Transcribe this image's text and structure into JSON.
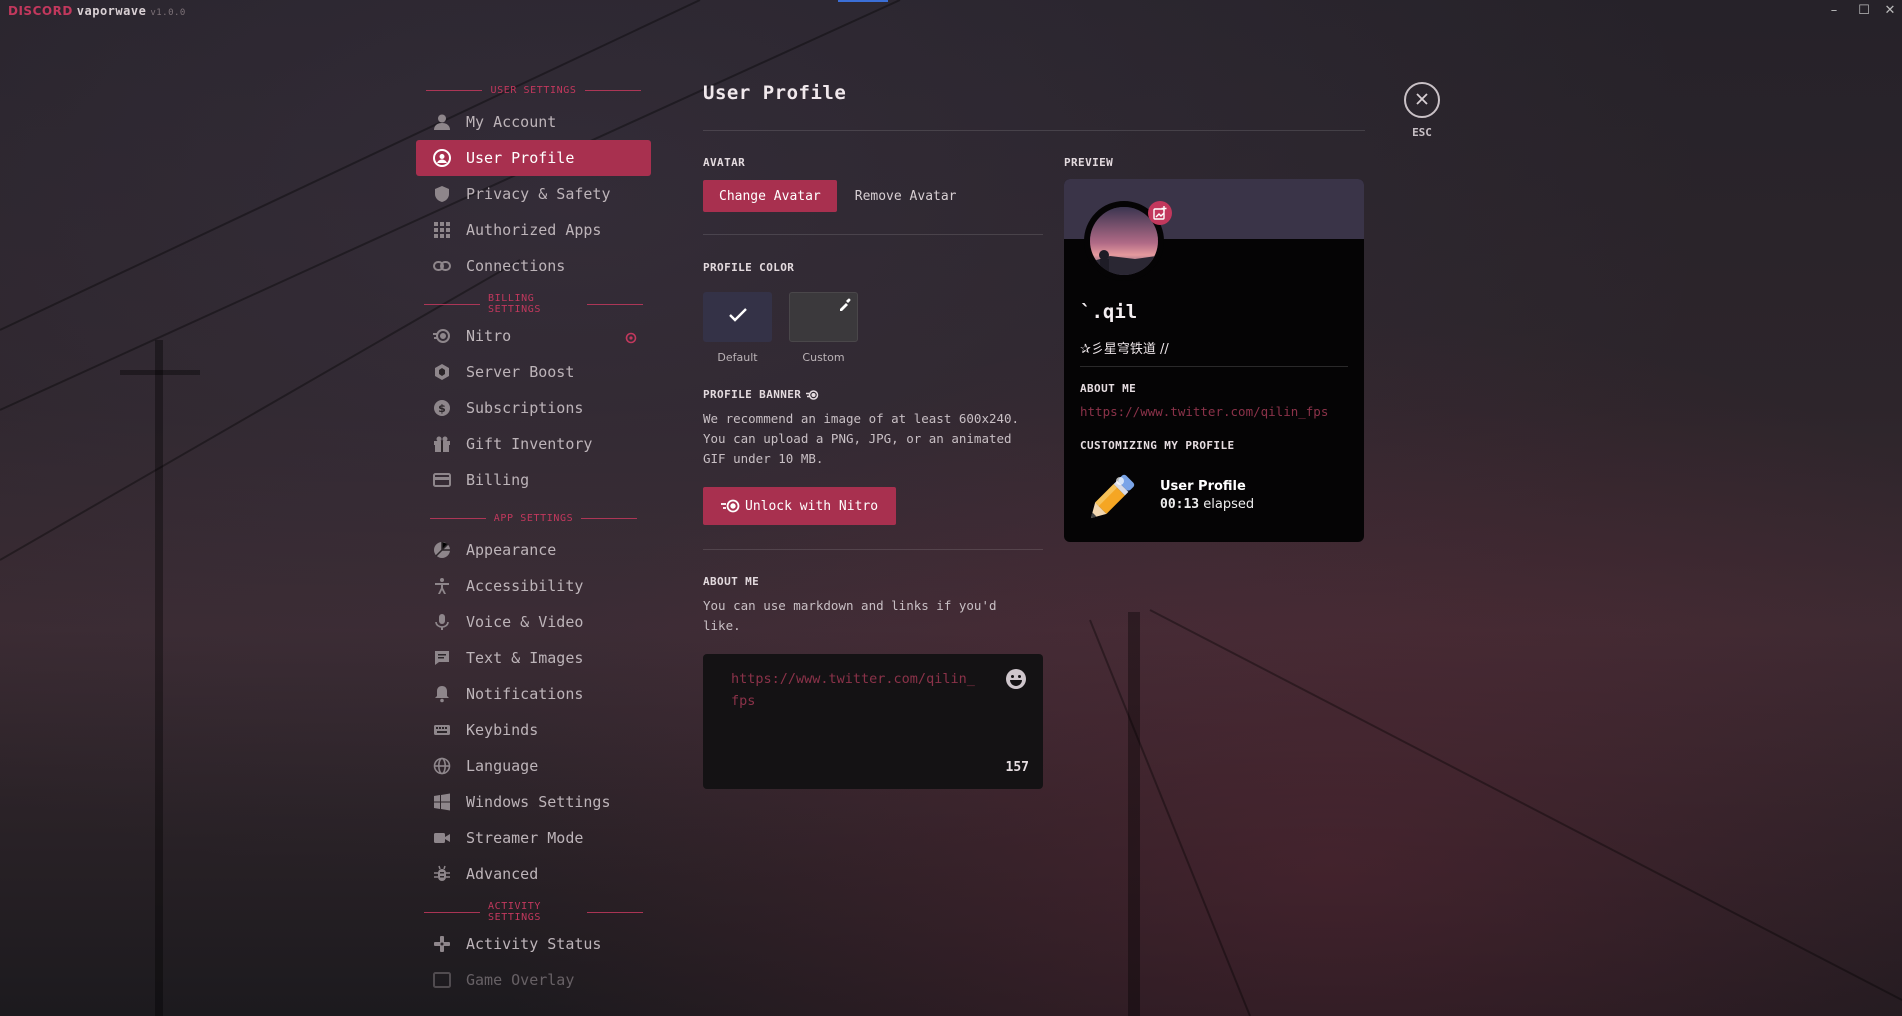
{
  "titlebar": {
    "brand": "DISCORD",
    "theme": "vaporwave",
    "version": "v1.0.0"
  },
  "colors": {
    "accent": "#a8304f",
    "accent_bright": "#c2385d",
    "link": "#8b3249",
    "card_bg": "#050405",
    "banner": "#3a3448"
  },
  "sidebar": {
    "sections": [
      {
        "header": "USER SETTINGS",
        "items": [
          {
            "label": "My Account",
            "icon": "person-icon"
          },
          {
            "label": "User Profile",
            "icon": "profile-icon",
            "active": true
          },
          {
            "label": "Privacy & Safety",
            "icon": "shield-icon"
          },
          {
            "label": "Authorized Apps",
            "icon": "grid-icon"
          },
          {
            "label": "Connections",
            "icon": "link-icon"
          }
        ]
      },
      {
        "header": "BILLING SETTINGS",
        "items": [
          {
            "label": "Nitro",
            "icon": "nitro-icon",
            "badge": "nitro-badge-icon"
          },
          {
            "label": "Server Boost",
            "icon": "boost-icon"
          },
          {
            "label": "Subscriptions",
            "icon": "dollar-icon"
          },
          {
            "label": "Gift Inventory",
            "icon": "gift-icon"
          },
          {
            "label": "Billing",
            "icon": "credit-card-icon"
          }
        ]
      },
      {
        "header": "APP SETTINGS",
        "items": [
          {
            "label": "Appearance",
            "icon": "palette-icon"
          },
          {
            "label": "Accessibility",
            "icon": "accessibility-icon"
          },
          {
            "label": "Voice & Video",
            "icon": "microphone-icon"
          },
          {
            "label": "Text & Images",
            "icon": "chat-icon"
          },
          {
            "label": "Notifications",
            "icon": "bell-icon"
          },
          {
            "label": "Keybinds",
            "icon": "keyboard-icon"
          },
          {
            "label": "Language",
            "icon": "globe-icon"
          },
          {
            "label": "Windows Settings",
            "icon": "windows-icon"
          },
          {
            "label": "Streamer Mode",
            "icon": "camera-icon"
          },
          {
            "label": "Advanced",
            "icon": "gear-bug-icon"
          }
        ]
      },
      {
        "header": "ACTIVITY SETTINGS",
        "items": [
          {
            "label": "Activity Status",
            "icon": "controller-icon"
          },
          {
            "label": "Game Overlay",
            "icon": "overlay-icon"
          }
        ]
      }
    ]
  },
  "main": {
    "title": "User Profile",
    "avatar": {
      "label": "AVATAR",
      "change": "Change Avatar",
      "remove": "Remove Avatar"
    },
    "profile_color": {
      "label": "PROFILE COLOR",
      "default": "Default",
      "custom": "Custom",
      "default_color": "#343247",
      "custom_color": "#3b393c"
    },
    "profile_banner": {
      "label": "PROFILE BANNER",
      "description": "We recommend an image of at least 600x240. You can upload a PNG, JPG, or an animated GIF under 10 MB.",
      "unlock": "Unlock with Nitro"
    },
    "about_me": {
      "label": "ABOUT ME",
      "description": "You can use markdown and links if you'd like.",
      "value": "https://www.twitter.com/qilin_fps",
      "remaining": "157"
    }
  },
  "preview": {
    "label": "PREVIEW",
    "username": "`.qil",
    "custom_status": "✰彡星穹铁道 //",
    "about_label": "ABOUT ME",
    "about_value": "https://www.twitter.com/qilin_fps",
    "customizing_label": "CUSTOMIZING MY PROFILE",
    "activity_title": "User Profile",
    "activity_time": "00:13",
    "activity_suffix": "elapsed"
  },
  "close": {
    "label": "ESC"
  }
}
